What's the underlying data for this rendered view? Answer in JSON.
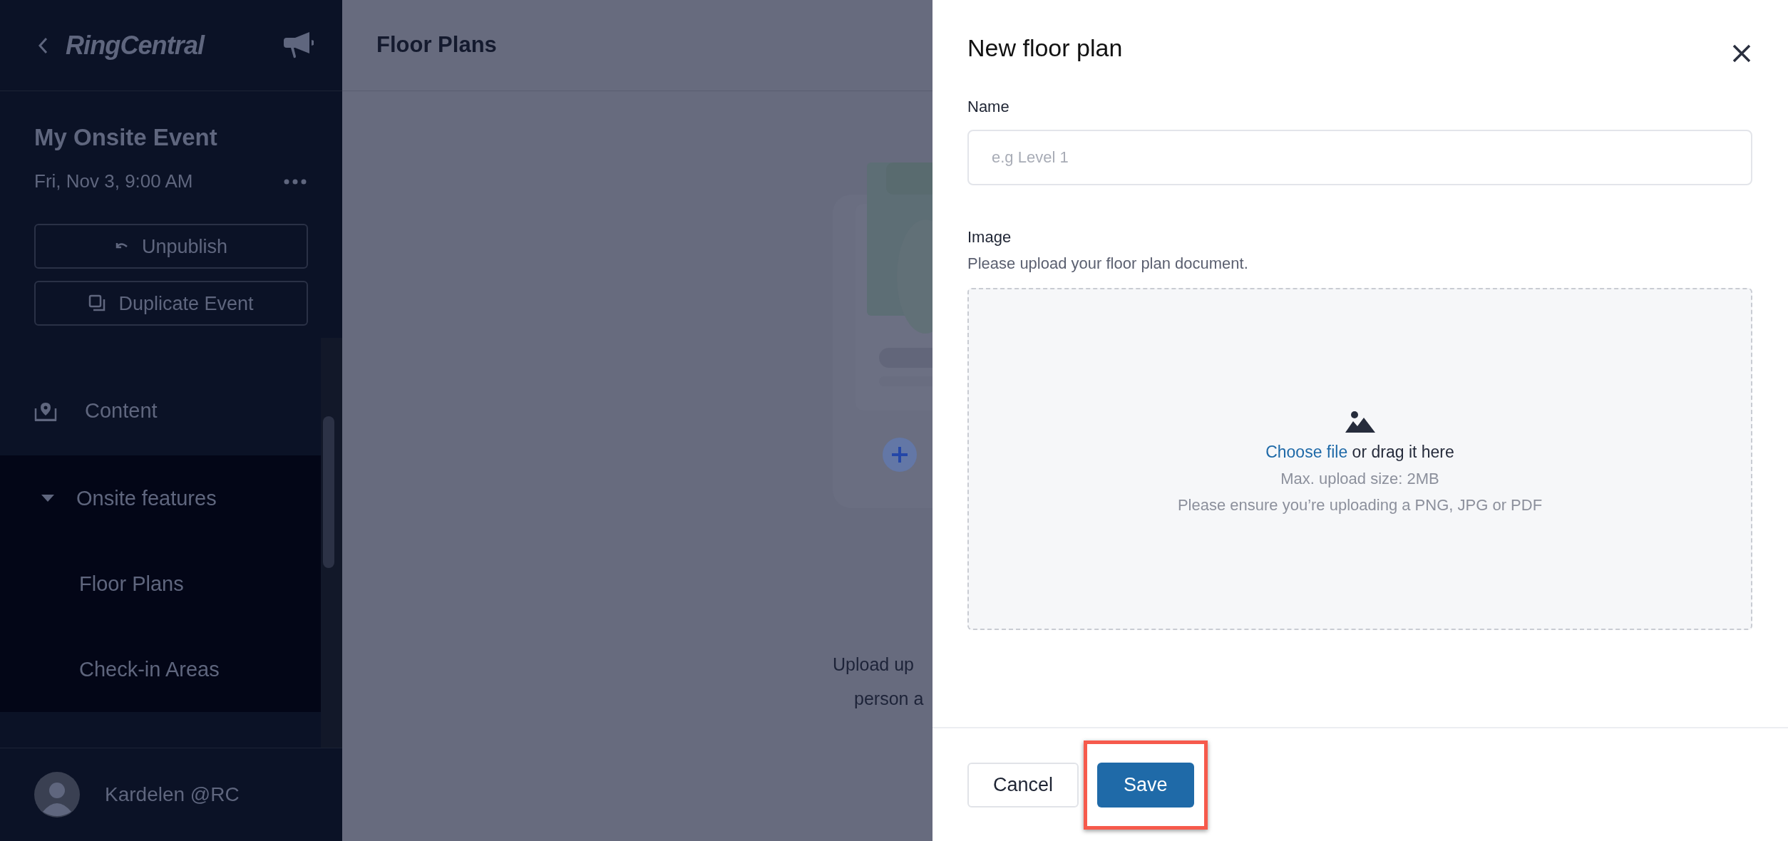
{
  "sidebar": {
    "logo": "RingCentral",
    "event": {
      "title": "My Onsite Event",
      "date": "Fri, Nov 3, 9:00 AM"
    },
    "actions": [
      {
        "label": "Unpublish",
        "kind": "undo"
      },
      {
        "label": "Duplicate Event",
        "kind": "duplicate"
      }
    ],
    "nav": [
      {
        "label": "Content",
        "kind": "item"
      },
      {
        "label": "Onsite features",
        "kind": "group",
        "expanded": true,
        "children": [
          {
            "label": "Floor Plans"
          },
          {
            "label": "Check-in Areas"
          }
        ]
      }
    ],
    "user": {
      "name": "Kardelen @RC"
    }
  },
  "page": {
    "title": "Floor Plans",
    "empty_text": [
      "Upload up",
      "person a"
    ]
  },
  "dialog": {
    "title": "New floor plan",
    "fields": [
      {
        "kind": "text",
        "label": "Name",
        "placeholder": "e.g Level 1"
      },
      {
        "kind": "upload",
        "label": "Image",
        "hint": "Please upload your floor plan document.",
        "link": "Choose file",
        "prompt": "or drag it here",
        "notes": [
          "Max. upload size: 2MB",
          "Please ensure you’re uploading a PNG, JPG or PDF"
        ]
      }
    ],
    "buttons": [
      {
        "label": "Cancel",
        "kind": "secondary",
        "highlighted": false
      },
      {
        "label": "Save",
        "kind": "primary",
        "highlighted": true
      }
    ]
  }
}
